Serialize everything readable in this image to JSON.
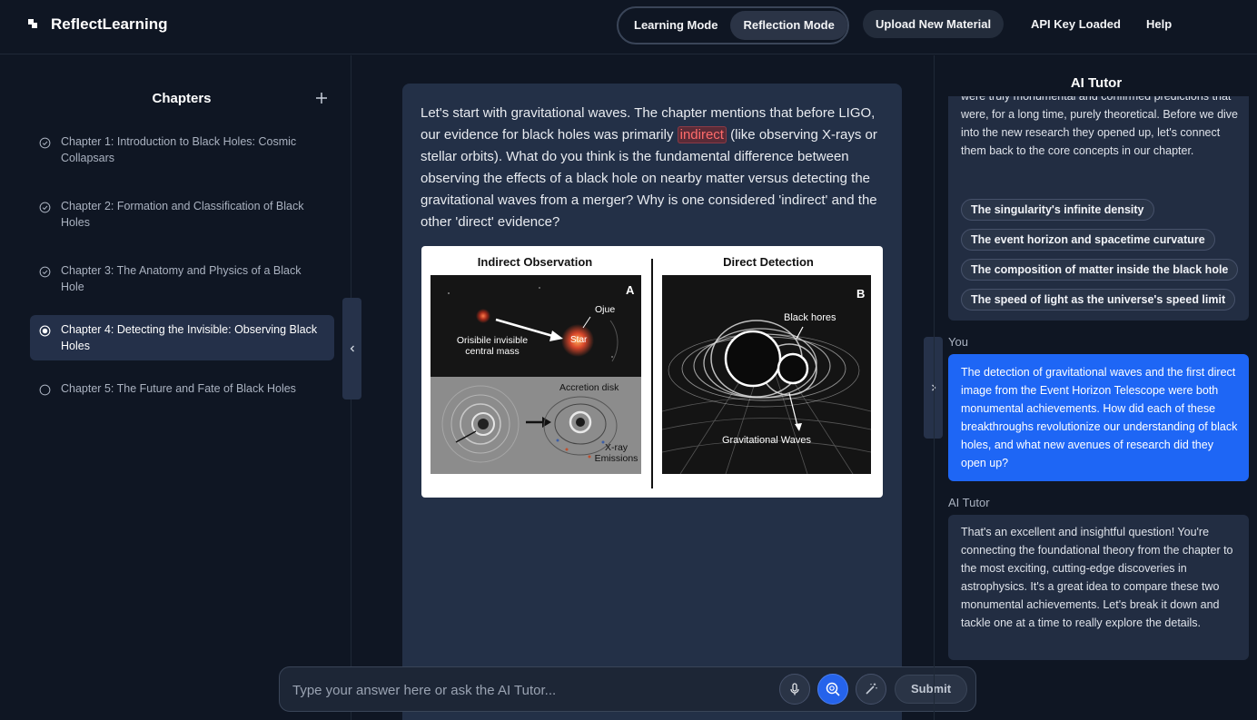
{
  "header": {
    "brand": "ReflectLearning",
    "modes": [
      "Learning Mode",
      "Reflection Mode"
    ],
    "active_mode": "Reflection Mode",
    "upload_label": "Upload New Material",
    "api_status": "API Key Loaded",
    "help_label": "Help"
  },
  "sidebar": {
    "title": "Chapters",
    "chapters": [
      {
        "label": "Chapter 1: Introduction to Black Holes: Cosmic Collapsars",
        "status": "completed"
      },
      {
        "label": "Chapter 2: Formation and Classification of Black Holes",
        "status": "completed"
      },
      {
        "label": "Chapter 3: The Anatomy and Physics of a Black Hole",
        "status": "completed"
      },
      {
        "label": "Chapter 4: Detecting the Invisible: Observing Black Holes",
        "status": "active"
      },
      {
        "label": "Chapter 5: The Future and Fate of Black Holes",
        "status": "pending"
      }
    ]
  },
  "main": {
    "question_part1": "Let's start with gravitational waves. The chapter mentions that before LIGO, our evidence for black holes was primarily ",
    "question_highlight": "indirect",
    "question_part2": " (like observing X-rays or stellar orbits). What do you think is the fundamental difference between observing the effects of a black hole on nearby matter versus detecting the gravitational waves from a merger? Why is one considered 'indirect' and the other 'direct' evidence?",
    "figure": {
      "left_title": "Indirect Observation",
      "right_title": "Direct Detection",
      "panel_a": "A",
      "panel_b": "B",
      "label_mass": "Orisibile invisible central mass",
      "label_oiue": "Ojue",
      "label_star": "Star",
      "label_accretion": "Accretion disk",
      "label_xray": "X-ray Emissions",
      "label_holes": "Black hores",
      "label_waves": "Gravitational Waves"
    }
  },
  "input": {
    "placeholder": "Type your answer here or ask the AI Tutor...",
    "submit_label": "Submit"
  },
  "tutor": {
    "title": "AI Tutor",
    "top_message": "were truly monumental and confirmed predictions that were, for a long time, purely theoretical. Before we dive into the new research they opened up, let's connect them back to the core concepts in our chapter.",
    "options": [
      "The singularity's infinite density",
      "The event horizon and spacetime curvature",
      "The composition of matter inside the black hole",
      "The speed of light as the universe's speed limit"
    ],
    "user_label": "You",
    "user_message": "The detection of gravitational waves and the first direct image from the Event Horizon Telescope were both monumental achievements. How did each of these breakthroughs revolutionize our understanding of black holes, and what new avenues of research did they open up?",
    "ai_label": "AI Tutor",
    "ai_message": "That's an excellent and insightful question! You're connecting the foundational theory from the chapter to the most exciting, cutting-edge discoveries in astrophysics. It's a great idea to compare these two monumental achievements. Let's break it down and tackle one at a time to really explore the details."
  },
  "colors": {
    "background": "#0f1623",
    "accent": "#1e66f5",
    "highlight": "#ff6b6b"
  }
}
